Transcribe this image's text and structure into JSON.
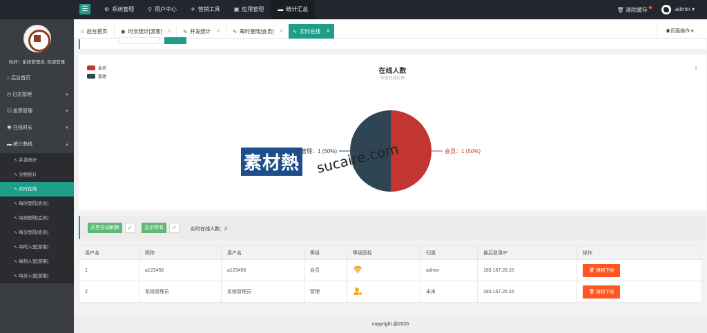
{
  "topbar": {
    "nav": [
      {
        "icon": "gear-icon",
        "label": "系统管理"
      },
      {
        "icon": "user-icon",
        "label": "用户中心"
      },
      {
        "icon": "tool-icon",
        "label": "营销工具"
      },
      {
        "icon": "app-icon",
        "label": "应用管理"
      },
      {
        "icon": "chat-icon",
        "label": "统计汇总"
      }
    ],
    "active_index": 4,
    "clear_cache": "清除缓存",
    "user": "admin"
  },
  "sidebar": {
    "welcome": "你好！系统管理员, 欢迎登录",
    "items": [
      {
        "label": "后台首页"
      },
      {
        "label": "日志管理"
      },
      {
        "label": "投票管理"
      },
      {
        "label": "在线时长"
      },
      {
        "label": "统计曲线"
      }
    ],
    "sub_items": [
      {
        "label": "并发统计"
      },
      {
        "label": "分组统计"
      },
      {
        "label": "实时在线"
      },
      {
        "label": "每时登陆[会员]"
      },
      {
        "label": "每刻登陆[会员]"
      },
      {
        "label": "每分登陆[会员]"
      },
      {
        "label": "每时入室[游客]"
      },
      {
        "label": "每刻入室[游客]"
      },
      {
        "label": "每分入室[游客]"
      }
    ]
  },
  "tabs": [
    {
      "label": "后台首页"
    },
    {
      "label": "时长统计[游客]"
    },
    {
      "label": "并发统计"
    },
    {
      "label": "每时登陆[会员]"
    },
    {
      "label": "实时在线"
    }
  ],
  "page_ops": "页面操作",
  "chart_data": {
    "type": "pie",
    "title": "在线人数",
    "subtitle": "分组在线比例",
    "legend": [
      "会员",
      "管理"
    ],
    "slices": [
      {
        "name": "会员",
        "value": 1,
        "percent": 50,
        "color": "#c23531",
        "label": "会员：1 (50%)"
      },
      {
        "name": "管理",
        "value": 1,
        "percent": 50,
        "color": "#2f4554",
        "label": "管理：1 (50%)"
      }
    ]
  },
  "controls": {
    "auto_refresh": "开启自动刷新",
    "show_all": "显示所有",
    "online_count": "实时在线人数：2"
  },
  "table": {
    "headers": [
      "用户名",
      "昵称",
      "用户名",
      "等级",
      "等级图标",
      "归属",
      "最后登录IP",
      "操作"
    ],
    "rows": [
      {
        "id": "1",
        "nick": "a123456",
        "user": "a123456",
        "level": "会员",
        "icon": "diamond-icon",
        "owner": "admin",
        "ip": "183.167.26.15",
        "action": "强制下线"
      },
      {
        "id": "2",
        "nick": "系统管理员",
        "user": "系统管理员",
        "level": "管理",
        "icon": "admin-user-icon",
        "owner": "未来",
        "ip": "183.167.26.15",
        "action": "强制下线"
      }
    ]
  },
  "footer": "copyright @2020",
  "watermark": {
    "cn": "素材熱",
    "en": "sucaire.com"
  }
}
